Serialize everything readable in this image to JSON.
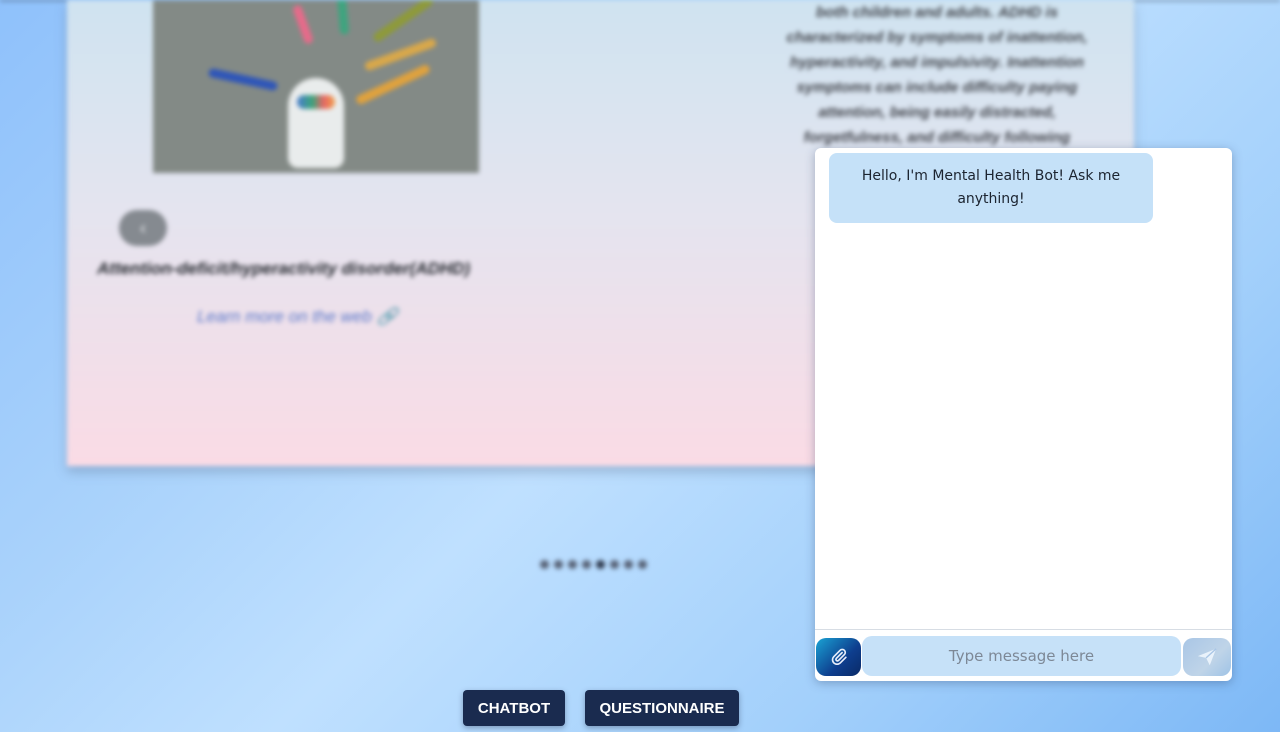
{
  "card": {
    "prev_label": "‹",
    "title": "Attention-deficit/hyperactivity disorder(ADHD)",
    "learn_more": "Learn more on the web 🔗",
    "description_lines": [
      "both children and adults. ADHD is",
      "characterized by symptoms of inattention,",
      "hyperactivity, and impulsivity. Inattention",
      "symptoms can include difficulty paying",
      "attention, being easily distracted,",
      "forgetfulness, and difficulty following"
    ]
  },
  "carousel": {
    "dot_count": 8,
    "active_index": 4
  },
  "chat": {
    "bot_greeting": "Hello, I'm Mental Health Bot! Ask me anything!",
    "input_placeholder": "Type message here",
    "attach_icon": "paperclip-icon",
    "send_icon": "paper-plane-icon"
  },
  "nav": {
    "chatbot_label": "CHATBOT",
    "questionnaire_label": "QUESTIONNAIRE"
  },
  "colors": {
    "nav_button_bg": "#1a2b4f",
    "bot_bubble": "#c5e1f8",
    "input_bg": "#c6e1f8"
  }
}
